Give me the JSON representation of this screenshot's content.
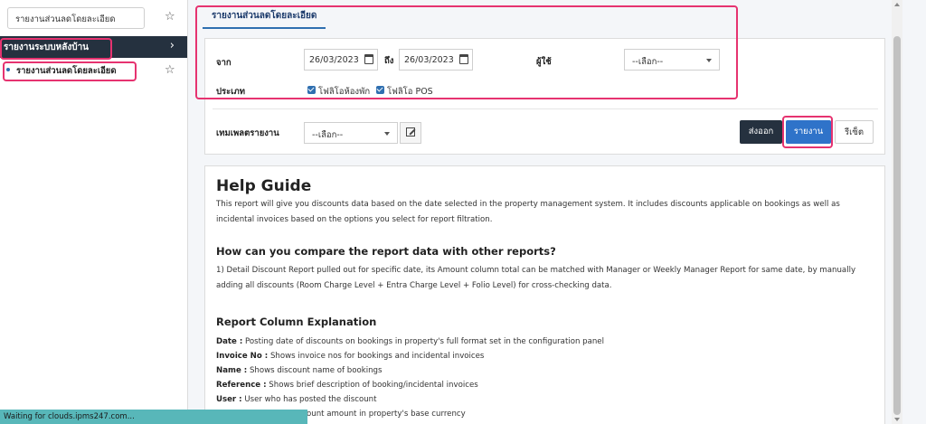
{
  "sidebar": {
    "search_value": "รายงานส่วนลดโดยละเอียด",
    "group_label": "รายงานระบบหลังบ้าน",
    "item_label": "รายงานส่วนลดโดยละเอียด"
  },
  "tab": {
    "label": "รายงานส่วนลดโดยละเอียด"
  },
  "filters": {
    "from_label": "จาก",
    "from_date": "26/03/2023",
    "to_label": "ถึง",
    "to_date": "26/03/2023",
    "user_label": "ผู้ใช้",
    "user_select": "--เลือก--",
    "type_label": "ประเภท",
    "folio_room_label": "โฟลิโอห้องพัก",
    "folio_pos_label": "โฟลิโอ POS",
    "template_label": "เทมเพลตรายงาน",
    "template_select": "--เลือก--"
  },
  "buttons": {
    "export": "ส่งออก",
    "report": "รายงาน",
    "reset": "รีเซ็ต"
  },
  "help": {
    "title": "Help Guide",
    "intro": "This report will give you discounts data based on the date selected in the property management system. It includes discounts applicable on bookings as well as incidental invoices based on the options you select for report filtration.",
    "h_compare": "How can you compare the report data with other reports?",
    "compare_text": "1) Detail Discount Report pulled out for specific date, its Amount column total can be matched with Manager or Weekly Manager Report for same date, by manually adding all discounts (Room Charge Level + Entra Charge Level + Folio Level) for cross-checking data.",
    "h_columns": "Report Column Explanation",
    "columns": [
      {
        "key": "Date :",
        "text": "Posting date of discounts on bookings in property's full format set in the configuration panel"
      },
      {
        "key": "Invoice No :",
        "text": "Shows invoice nos for bookings and incidental invoices"
      },
      {
        "key": "Name :",
        "text": "Shows discount name of bookings"
      },
      {
        "key": "Reference :",
        "text": "Shows brief description of booking/incidental invoices"
      },
      {
        "key": "User :",
        "text": "User who has posted the discount"
      },
      {
        "key": "",
        "text": "ount amount in property's base currency"
      }
    ]
  },
  "status": {
    "text": "Waiting for clouds.ipms247.com..."
  },
  "colors": {
    "accent": "#2f73c9",
    "dark": "#25313f",
    "highlight": "#e63370",
    "status_bg": "#58b7b9"
  }
}
